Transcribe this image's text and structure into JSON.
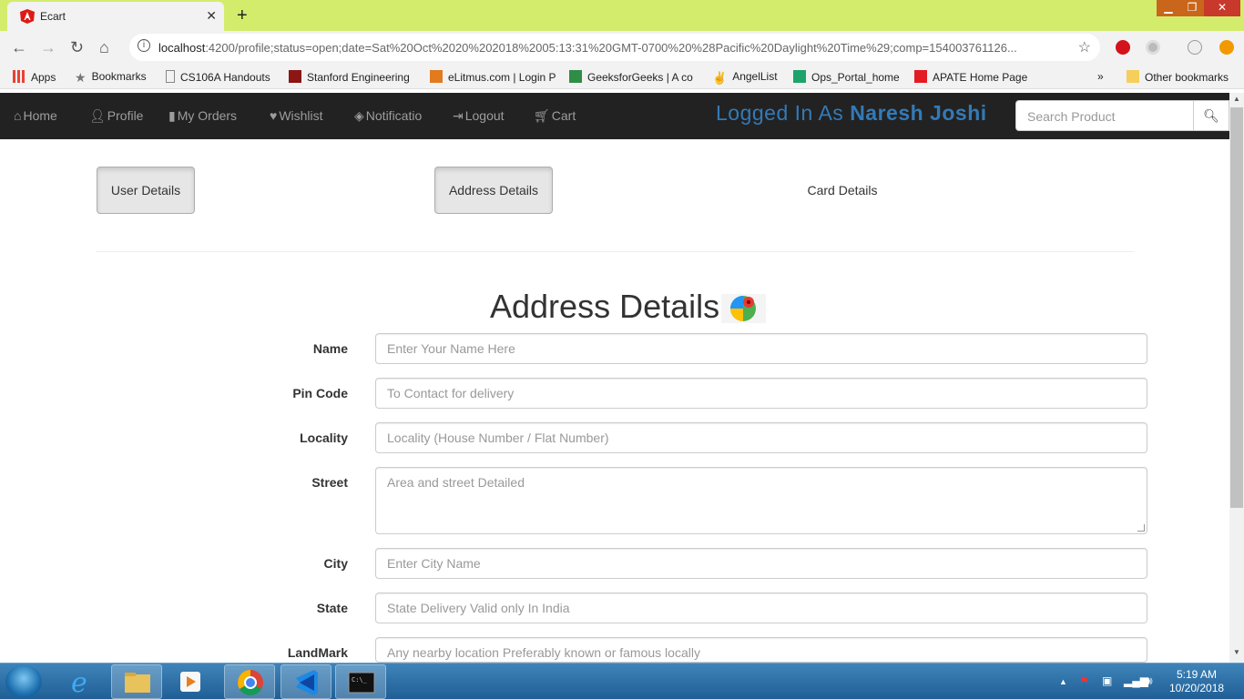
{
  "browser": {
    "tab_title": "Ecart",
    "url_host": "localhost",
    "url_rest": ":4200/profile;status=open;date=Sat%20Oct%2020%202018%2005:13:31%20GMT-0700%20%28Pacific%20Daylight%20Time%29;comp=154003761126...",
    "bookmarks": [
      "Apps",
      "Bookmarks",
      "CS106A Handouts",
      "Stanford Engineering",
      "eLitmus.com | Login P",
      "GeeksforGeeks | A co",
      "AngelList",
      "Ops_Portal_home",
      "APATE Home Page"
    ],
    "overflow": "»",
    "other_bookmarks": "Other bookmarks"
  },
  "navbar": {
    "items": [
      "Home",
      "Profile",
      "My Orders",
      "Wishlist",
      "Notificatio",
      "Logout",
      "Cart"
    ],
    "logged_prefix": "Logged In As",
    "user_name": "Naresh Joshi",
    "search_placeholder": "Search Product"
  },
  "profile_tabs": {
    "user": "User Details",
    "address": "Address Details",
    "card": "Card Details"
  },
  "form": {
    "heading": "Address Details",
    "fields": [
      {
        "label": "Name",
        "placeholder": "Enter Your Name Here"
      },
      {
        "label": "Pin Code",
        "placeholder": "To Contact for delivery"
      },
      {
        "label": "Locality",
        "placeholder": "Locality (House Number / Flat Number)"
      },
      {
        "label": "Street",
        "placeholder": "Area and street Detailed"
      },
      {
        "label": "City",
        "placeholder": "Enter City Name"
      },
      {
        "label": "State",
        "placeholder": "State Delivery Valid only In India"
      },
      {
        "label": "LandMark",
        "placeholder": "Any nearby location Preferably known or famous locally"
      }
    ]
  },
  "taskbar": {
    "time": "5:19 AM",
    "date": "10/20/2018"
  },
  "colors": {
    "chrome_frame": "#d4ec6c",
    "navbar_bg": "#222222",
    "accent_blue": "#337ab7"
  }
}
